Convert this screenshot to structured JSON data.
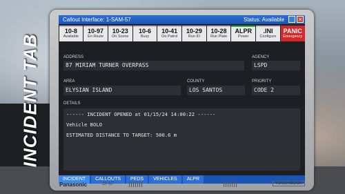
{
  "overlay_title": "INCIDENT TAB",
  "window": {
    "title": "Callout Interface:  1-SAM-57",
    "status": "Status: Available"
  },
  "toolbar": [
    {
      "code": "10-8",
      "sub": "Available",
      "style": "normal"
    },
    {
      "code": "10-97",
      "sub": "En Route",
      "style": "normal"
    },
    {
      "code": "10-23",
      "sub": "On Scene",
      "style": "normal"
    },
    {
      "code": "10-6",
      "sub": "Busy",
      "style": "normal"
    },
    {
      "code": "10-41",
      "sub": "On Patrol",
      "style": "normal"
    },
    {
      "code": "10-29",
      "sub": "Run ID",
      "style": "normal"
    },
    {
      "code": "10-28",
      "sub": "Run Plate",
      "style": "normal"
    },
    {
      "code": "ALPR",
      "sub": "Power",
      "style": "green"
    },
    {
      "code": ".INI",
      "sub": "Configure",
      "style": "normal"
    },
    {
      "code": "PANIC",
      "sub": "Emergency",
      "style": "panic"
    }
  ],
  "fields": {
    "address": {
      "label": "ADDRESS",
      "value": "87 MIRIAM TURNER OVERPASS"
    },
    "agency": {
      "label": "AGENCY",
      "value": "LSPD"
    },
    "area": {
      "label": "AREA",
      "value": "ELYSIAN ISLAND"
    },
    "county": {
      "label": "COUNTY",
      "value": "LOS SANTOS"
    },
    "priority": {
      "label": "PRIORITY",
      "value": "CODE 2"
    }
  },
  "details": {
    "label": "DETAILS",
    "lines": [
      "------ INCIDENT OPENED at 01/15/24 14:00:22 ------",
      "Vehicle BOLO",
      "ESTIMATED DISTANCE TO TARGET: 500.6 m"
    ]
  },
  "tabs": [
    "INCIDENT",
    "CALLOUTS",
    "PEDS",
    "VEHICLES",
    "ALPR"
  ],
  "device": {
    "brand": "Panasonic",
    "model": "CF-67",
    "series": "TOUGHBOOK"
  },
  "colors": {
    "titlebar": "#1a55b5",
    "panic": "#d12a2a",
    "alpr_active": "#27b33f"
  }
}
